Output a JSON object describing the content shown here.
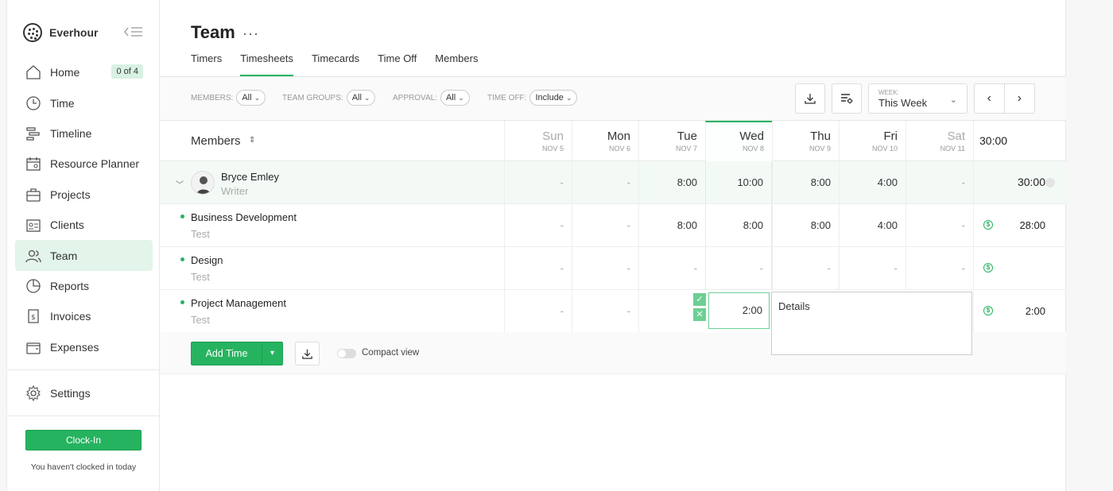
{
  "brand": {
    "name": "Everhour"
  },
  "sidebar": {
    "items": [
      {
        "label": "Home",
        "icon": "home-icon",
        "badge": "0 of 4"
      },
      {
        "label": "Time",
        "icon": "clock-icon"
      },
      {
        "label": "Timeline",
        "icon": "timeline-icon"
      },
      {
        "label": "Resource Planner",
        "icon": "calendar-icon"
      },
      {
        "label": "Projects",
        "icon": "briefcase-icon"
      },
      {
        "label": "Clients",
        "icon": "contact-card-icon"
      },
      {
        "label": "Team",
        "icon": "users-icon",
        "active": true
      },
      {
        "label": "Reports",
        "icon": "pie-chart-icon"
      },
      {
        "label": "Invoices",
        "icon": "invoice-icon"
      },
      {
        "label": "Expenses",
        "icon": "wallet-icon"
      }
    ],
    "settings_label": "Settings",
    "clockin_label": "Clock-In",
    "clockin_note": "You haven't clocked in today"
  },
  "page": {
    "title": "Team",
    "more": "···",
    "tabs": [
      "Timers",
      "Timesheets",
      "Timecards",
      "Time Off",
      "Members"
    ],
    "active_tab": "Timesheets"
  },
  "filters": [
    {
      "label": "Members:",
      "value": "All"
    },
    {
      "label": "Team groups:",
      "value": "All"
    },
    {
      "label": "Approval:",
      "value": "All"
    },
    {
      "label": "Time off:",
      "value": "Include"
    }
  ],
  "week": {
    "label": "Week:",
    "value": "This Week"
  },
  "table": {
    "members_header": "Members",
    "days": [
      {
        "name": "Sun",
        "date": "NOV 5",
        "weekend": true
      },
      {
        "name": "Mon",
        "date": "NOV 6"
      },
      {
        "name": "Tue",
        "date": "NOV 7"
      },
      {
        "name": "Wed",
        "date": "NOV 8",
        "today": true
      },
      {
        "name": "Thu",
        "date": "NOV 9"
      },
      {
        "name": "Fri",
        "date": "NOV 10"
      },
      {
        "name": "Sat",
        "date": "NOV 11",
        "weekend": true
      }
    ],
    "total": "30:00",
    "user": {
      "name": "Bryce Emley",
      "role": "Writer",
      "values": [
        "-",
        "-",
        "8:00",
        "10:00",
        "8:00",
        "4:00",
        "-"
      ],
      "total": "30:00"
    },
    "projects": [
      {
        "name": "Business Development",
        "task": "Test",
        "values": [
          "-",
          "-",
          "8:00",
          "8:00",
          "8:00",
          "4:00",
          "-"
        ],
        "total": "28:00"
      },
      {
        "name": "Design",
        "task": "Test",
        "values": [
          "-",
          "-",
          "-",
          "-",
          "-",
          "-",
          "-"
        ],
        "total": ""
      },
      {
        "name": "Project Management",
        "task": "Test",
        "values": [
          "-",
          "-",
          "",
          "",
          "",
          "",
          ""
        ],
        "total": "2:00"
      }
    ],
    "editing": {
      "value": "2:00",
      "details_placeholder": "Details",
      "billable_symbol": "$"
    }
  },
  "footer": {
    "add_time_label": "Add Time",
    "compact_view_label": "Compact view"
  },
  "colors": {
    "accent": "#26b35f",
    "accent_light": "#e3f4ea"
  }
}
